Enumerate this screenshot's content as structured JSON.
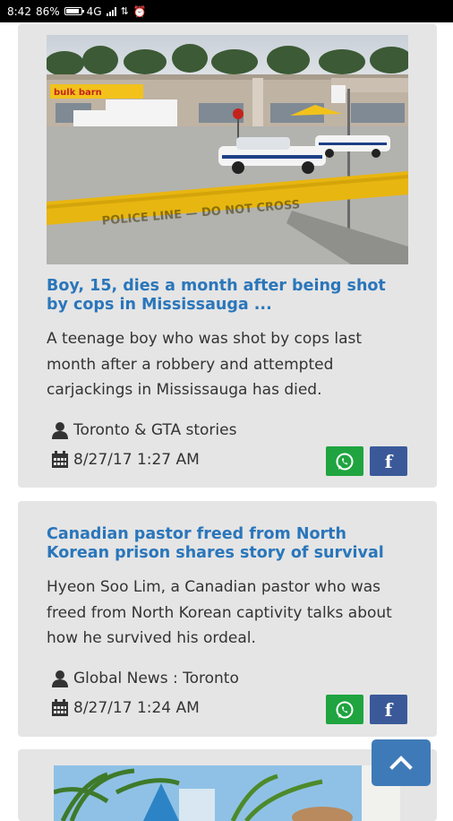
{
  "status_bar": {
    "time": "8:42",
    "battery_percent": "86%",
    "network": "4G"
  },
  "articles": [
    {
      "title": "Boy, 15, dies a month after being shot by cops in Mississauga ...",
      "description": "A teenage boy who was shot by cops last month after a robbery and attempted carjackings in Mississauga has died.",
      "source": "Toronto & GTA stories",
      "date": "8/27/17 1:27 AM",
      "image": {
        "store_sign": "bulk barn",
        "police_tape": "POLICE LINE — DO NOT CROSS"
      }
    },
    {
      "title": "Canadian pastor freed from North Korean prison shares story of survival",
      "description": "Hyeon Soo Lim, a Canadian pastor who was freed from North Korean captivity talks about how he survived his ordeal.",
      "source": "Global News : Toronto",
      "date": "8/27/17 1:24 AM"
    }
  ],
  "share": {
    "whatsapp_icon": "whatsapp-icon",
    "facebook_icon": "facebook-icon",
    "facebook_glyph": "f"
  },
  "icons": {
    "source": "user-icon",
    "date": "calendar-icon",
    "scroll_top": "chevron-up-icon"
  },
  "colors": {
    "title": "#2a76bb",
    "whatsapp": "#1fa440",
    "facebook": "#3b5999",
    "scroll_button": "#3f7ab8",
    "card": "#e5e5e5"
  }
}
